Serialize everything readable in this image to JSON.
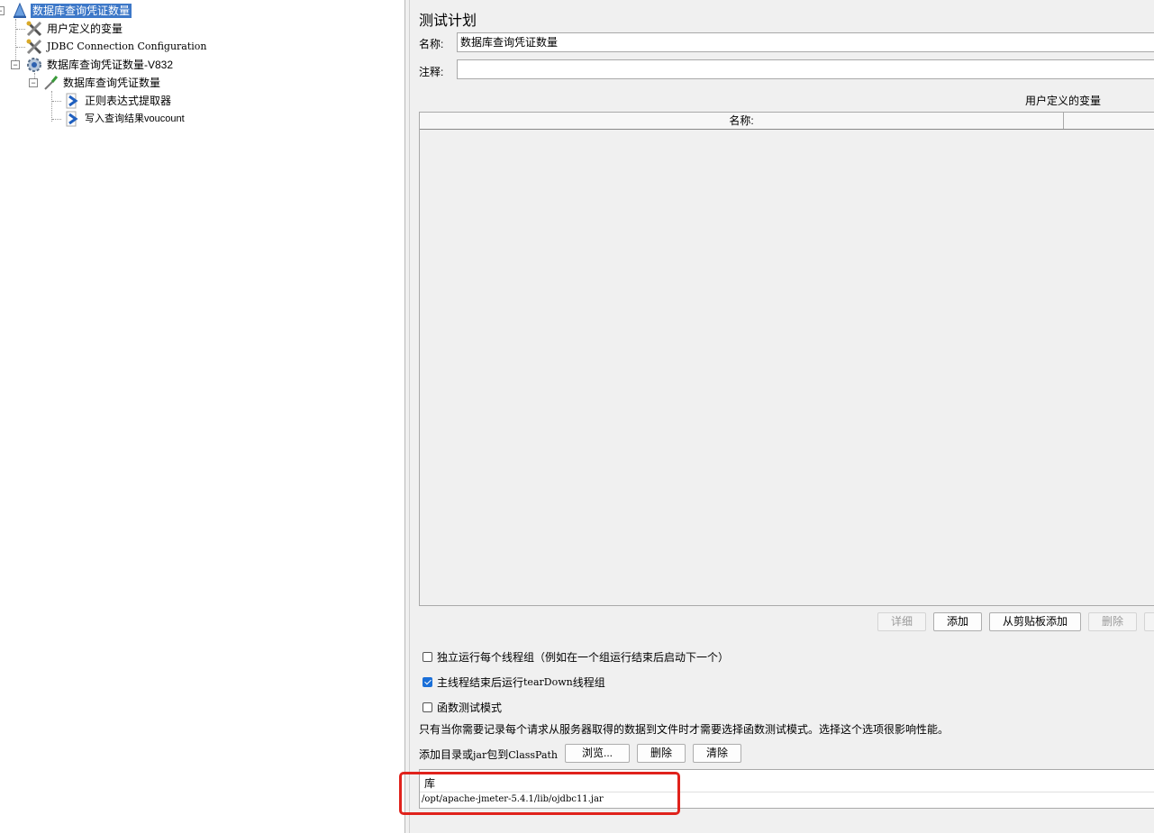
{
  "tree": {
    "root": "数据库查询凭证数量",
    "user_vars": "用户定义的变量",
    "jdbc_config": "JDBC Connection Configuration",
    "thread_group": "数据库查询凭证数量-V832",
    "sampler": "数据库查询凭证数量",
    "regex_extractor": "正则表达式提取器",
    "write_result": "写入查询结果voucount"
  },
  "panel": {
    "title": "测试计划",
    "name_label": "名称:",
    "name_value": "数据库查询凭证数量",
    "comment_label": "注释:",
    "comment_value": "",
    "user_vars_title": "用户定义的变量",
    "table_col_name": "名称:",
    "buttons": {
      "detail": "详细",
      "add": "添加",
      "add_from_clipboard": "从剪贴板添加",
      "delete": "删除"
    },
    "options": {
      "serialize_groups": "独立运行每个线程组（例如在一个组运行结束后启动下一个）",
      "serialize_groups_checked": false,
      "teardown_on_shutdown_prefix": "主线程结束后运行 ",
      "teardown_on_shutdown_mono": "tearDown",
      "teardown_on_shutdown_suffix": "线程组",
      "teardown_on_shutdown_checked": true,
      "functional_mode": "函数测试模式",
      "functional_mode_checked": false,
      "functional_mode_note": "只有当你需要记录每个请求从服务器取得的数据到文件时才需要选择函数测试模式。选择这个选项很影响性能。"
    },
    "classpath": {
      "label_prefix": "添加目录或",
      "label_mono1": "jar",
      "label_mid": "包到",
      "label_mono2": "ClassPath",
      "browse": "浏览...",
      "delete": "删除",
      "clear": "清除",
      "lib_header": "库",
      "lib_path": "/opt/apache-jmeter-5.4.1/lib/ojdbc11.jar"
    }
  },
  "colors": {
    "selection": "#3d78c8",
    "highlight_box": "#e0221c",
    "checkbox_on": "#1a6fd8"
  }
}
